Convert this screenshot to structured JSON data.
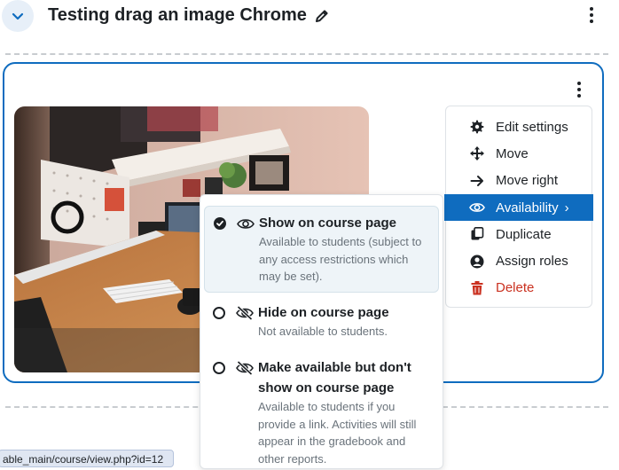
{
  "section": {
    "title": "Testing drag an image Chrome"
  },
  "action_menu": {
    "items": [
      {
        "label": "Edit settings",
        "icon": "gear-icon"
      },
      {
        "label": "Move",
        "icon": "move-arrows-icon"
      },
      {
        "label": "Move right",
        "icon": "arrow-right-icon"
      },
      {
        "label": "Availability",
        "icon": "eye-icon",
        "submenu_indicator": "›"
      },
      {
        "label": "Duplicate",
        "icon": "copy-icon"
      },
      {
        "label": "Assign roles",
        "icon": "user-circle-icon"
      },
      {
        "label": "Delete",
        "icon": "trash-icon"
      }
    ],
    "active_item": "Availability",
    "danger_color": "#ca3120",
    "accent_color": "#0f6cbf"
  },
  "availability": {
    "options": [
      {
        "title": "Show on course page",
        "description": "Available to students (subject to any access restrictions which may be set).",
        "selected": true,
        "icon": "eye-icon"
      },
      {
        "title": "Hide on course page",
        "description": "Not available to students.",
        "selected": false,
        "icon": "eye-slash-icon"
      },
      {
        "title": "Make available but don't show on course page",
        "description": "Available to students if you provide a link. Activities will still appear in the gradebook and other reports.",
        "selected": false,
        "icon": "eye-slash-icon"
      }
    ]
  },
  "status_bar": {
    "url": "able_main/course/view.php?id=12"
  },
  "image": {
    "description_icon": "desk-workspace-photo"
  }
}
